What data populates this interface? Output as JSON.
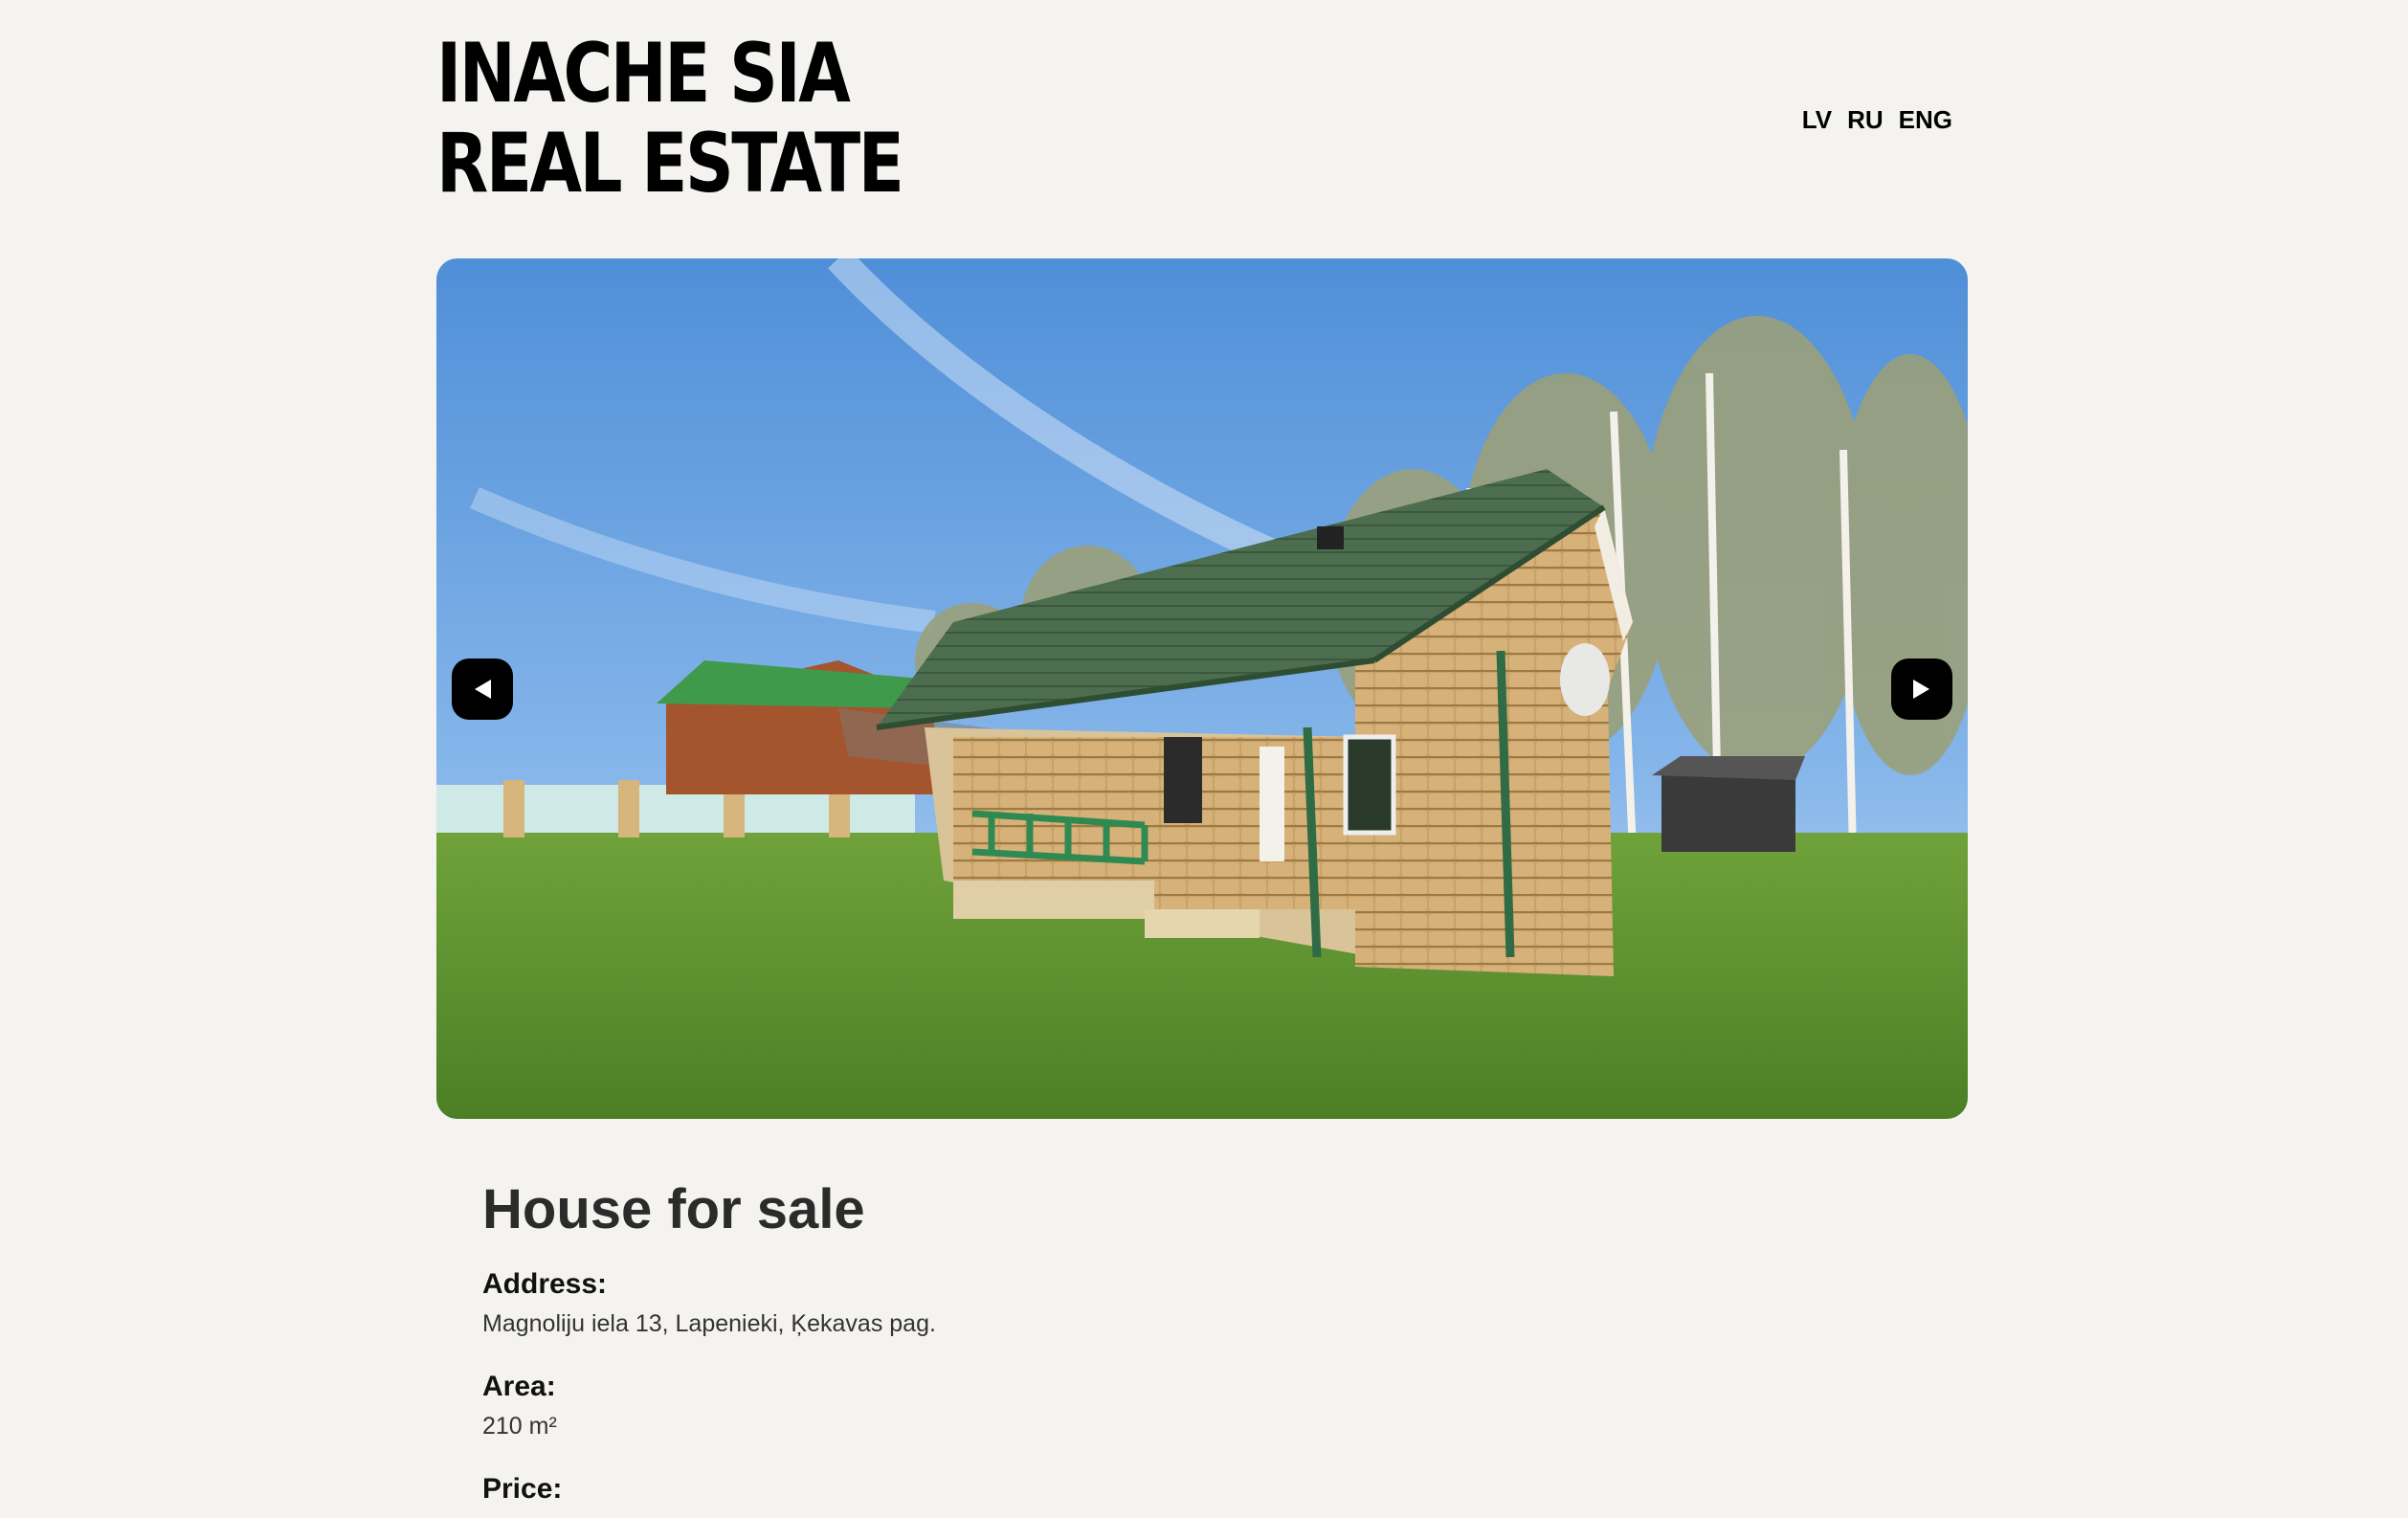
{
  "brand": {
    "line1": "INACHE SIA",
    "line2": "REAL ESTATE"
  },
  "languages": [
    "LV",
    "RU",
    "ENG"
  ],
  "gallery": {
    "prev_icon": "chevron-left-icon",
    "next_icon": "chevron-right-icon"
  },
  "listing": {
    "title": "House for sale",
    "address_label": "Address:",
    "address": "Magnoliju iela 13, Lapenieki, Ķekavas pag.",
    "area_label": "Area:",
    "area": "210 m²",
    "price_label": "Price:"
  }
}
